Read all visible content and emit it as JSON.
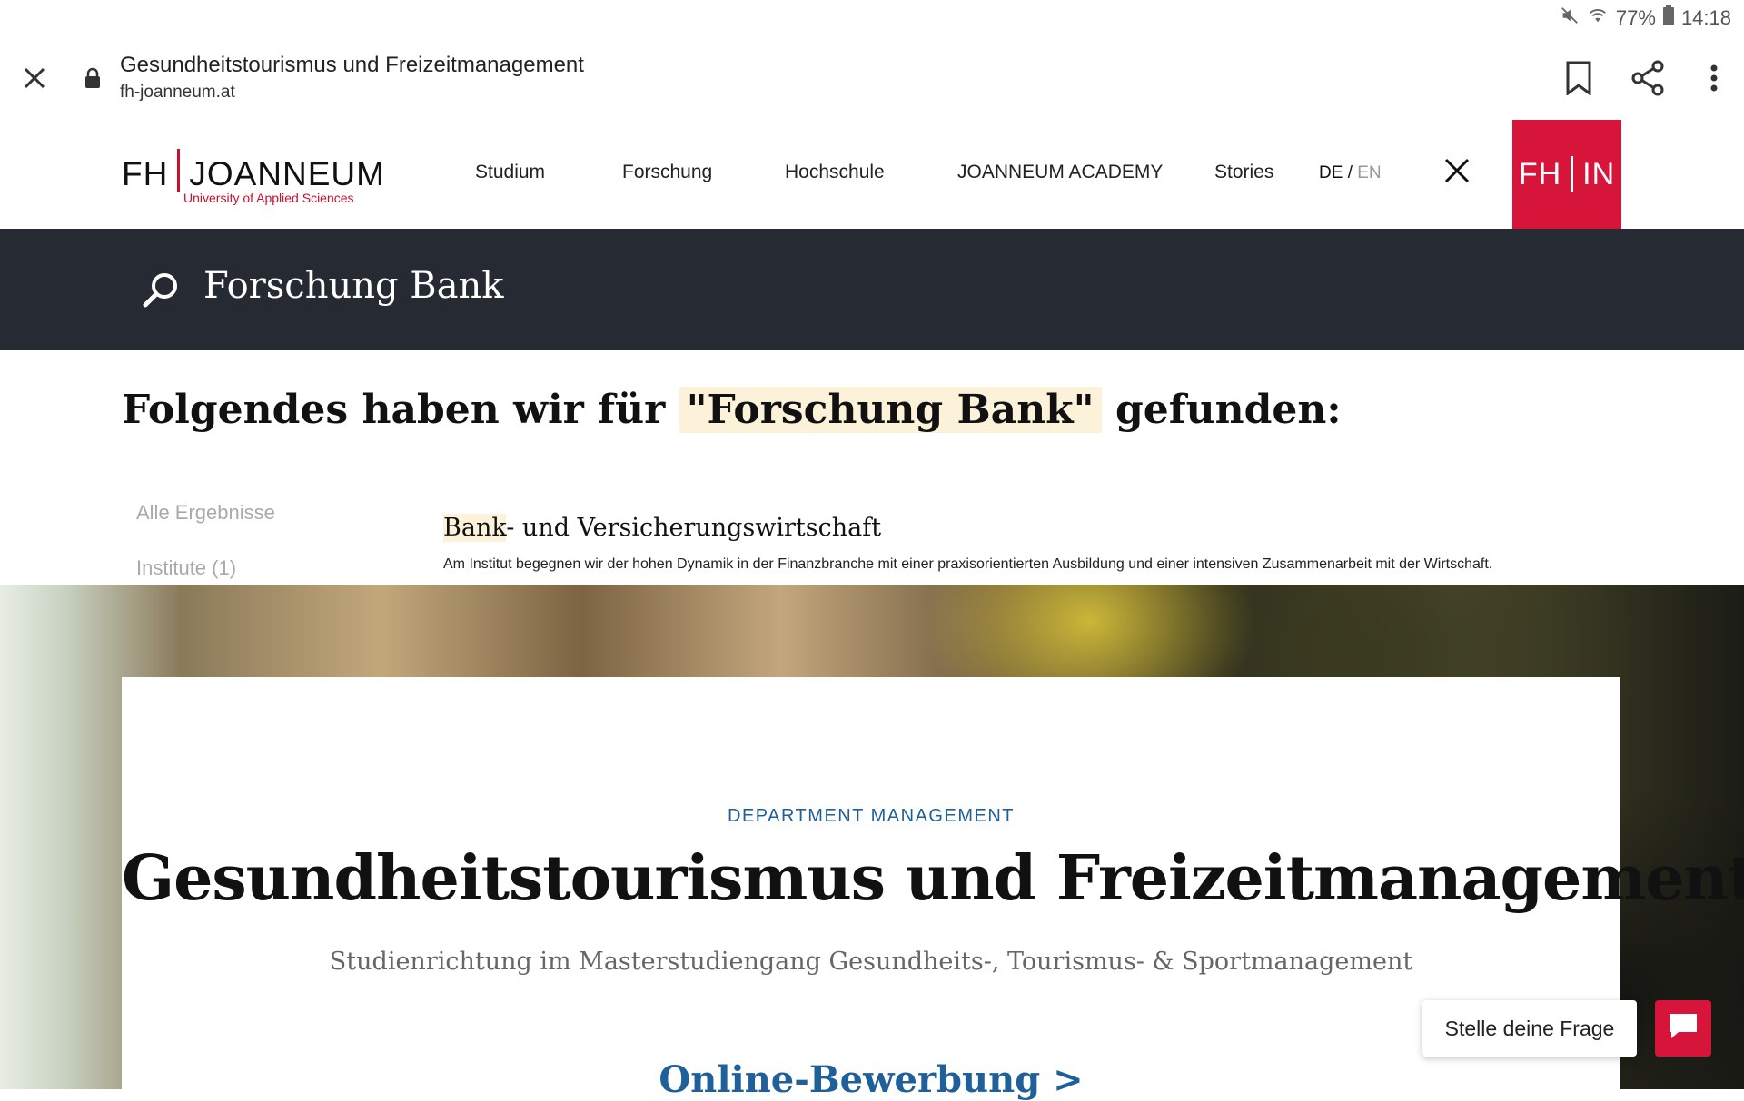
{
  "status_bar": {
    "battery": "77%",
    "time": "14:18",
    "icons": [
      "mute-icon",
      "wifi-icon",
      "battery-icon"
    ]
  },
  "browser": {
    "title": "Gesundheitstourismus und Freizeitmanagement",
    "url": "fh-joanneum.at",
    "icons": [
      "close-icon",
      "lock-icon",
      "bookmark-icon",
      "share-icon",
      "more-vert-icon"
    ]
  },
  "site": {
    "logo": {
      "left": "FH",
      "right": "JOANNEUM",
      "tagline": "University of Applied Sciences"
    },
    "nav": [
      "Studium",
      "Forschung",
      "Hochschule",
      "JOANNEUM ACADEMY",
      "Stories"
    ],
    "lang": {
      "de": "DE",
      "separator": "/",
      "en": "EN"
    },
    "fhin": {
      "left": "FH",
      "right": "IN"
    }
  },
  "search": {
    "query": "Forschung Bank"
  },
  "results": {
    "heading_prefix": "Folgendes haben wir für",
    "heading_query": "\"Forschung Bank\"",
    "heading_suffix": "gefunden:",
    "filters": [
      "Alle Ergebnisse",
      "Institute (1)"
    ],
    "items": [
      {
        "title_highlight": "Bank",
        "title_rest": "- und Versicherungswirtschaft",
        "description": "Am Institut begegnen wir der hohen Dynamik in der Finanzbranche mit einer praxisorientierten Ausbildung und einer intensiven Zusammenarbeit mit der Wirtschaft."
      }
    ]
  },
  "hero": {
    "kicker": "DEPARTMENT MANAGEMENT",
    "title": "Gesundheitstourismus und Freizeitmanagement",
    "subtitle": "Studienrichtung im Masterstudiengang Gesundheits-, Tourismus- & Sportmanagement",
    "cta": "Online-Bewerbung >"
  },
  "chat": {
    "label": "Stelle deine Frage"
  },
  "colors": {
    "brand_red": "#d7153a",
    "dark_band": "#262b33",
    "link_blue": "#1f5f9a",
    "highlight": "#fbf2d9"
  }
}
